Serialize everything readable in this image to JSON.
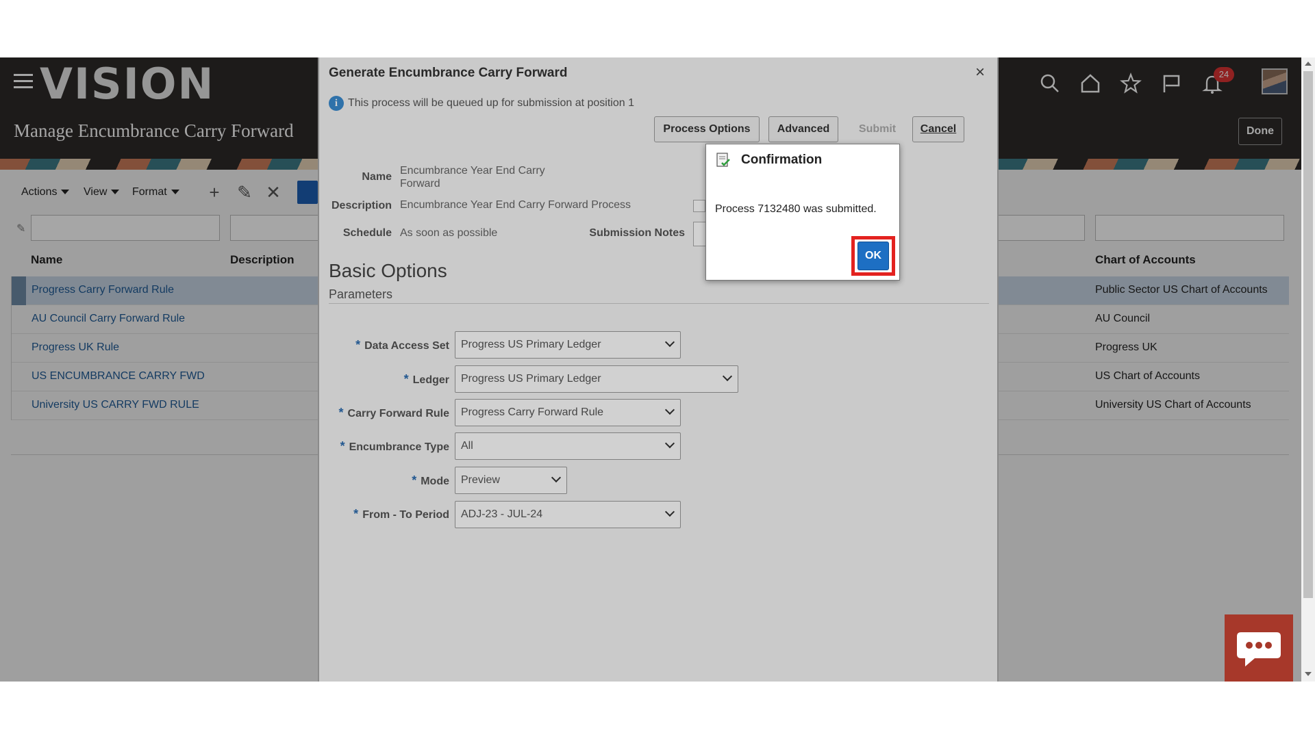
{
  "app": {
    "logo": "VISION",
    "page_title": "Manage Encumbrance Carry Forward",
    "done_label": "Done",
    "notification_count": "24"
  },
  "header_icons": [
    "search-icon",
    "home-icon",
    "star-icon",
    "flag-icon",
    "bell-icon"
  ],
  "toolbar": {
    "actions": "Actions",
    "view": "View",
    "format": "Format"
  },
  "table": {
    "headers": {
      "name": "Name",
      "description": "Description",
      "chart": "Chart of Accounts"
    },
    "rows": [
      {
        "name": "Progress Carry Forward Rule",
        "chart": "Public Sector US Chart of Accounts",
        "selected": true
      },
      {
        "name": "AU Council Carry Forward Rule",
        "chart": "AU Council",
        "selected": false
      },
      {
        "name": "Progress UK Rule",
        "chart": "Progress UK",
        "selected": false
      },
      {
        "name": "US ENCUMBRANCE CARRY FWD",
        "chart": "US Chart of Accounts",
        "selected": false
      },
      {
        "name": "University US CARRY FWD RULE",
        "chart": "University US Chart of Accounts",
        "selected": false
      }
    ]
  },
  "dialog": {
    "title": "Generate Encumbrance Carry Forward",
    "close": "×",
    "info": "This process will be queued up for submission at position 1",
    "buttons": {
      "process_options": "Process Options",
      "advanced": "Advanced",
      "submit": "Submit",
      "cancel": "Cancel"
    },
    "name_label": "Name",
    "name_value": "Encumbrance Year End Carry Forward",
    "description_label": "Description",
    "description_value": "Encumbrance Year End Carry Forward Process",
    "schedule_label": "Schedule",
    "schedule_value": "As soon as possible",
    "notes_label": "Submission Notes",
    "basic_options": "Basic Options",
    "parameters": "Parameters",
    "fields": [
      {
        "label": "Data Access Set",
        "value": "Progress US Primary Ledger"
      },
      {
        "label": "Ledger",
        "value": "Progress US Primary Ledger"
      },
      {
        "label": "Carry Forward Rule",
        "value": "Progress Carry Forward Rule"
      },
      {
        "label": "Encumbrance Type",
        "value": "All"
      },
      {
        "label": "Mode",
        "value": "Preview"
      },
      {
        "label": "From - To Period",
        "value": "ADJ-23 - JUL-24"
      }
    ]
  },
  "confirmation": {
    "title": "Confirmation",
    "message": "Process 7132480 was submitted.",
    "ok": "OK"
  },
  "colors": {
    "header_bg": "#2d2a28",
    "link": "#1e5a96",
    "ok_button": "#1d6fc3",
    "highlight": "#e3221f",
    "chat": "#a7382a"
  }
}
